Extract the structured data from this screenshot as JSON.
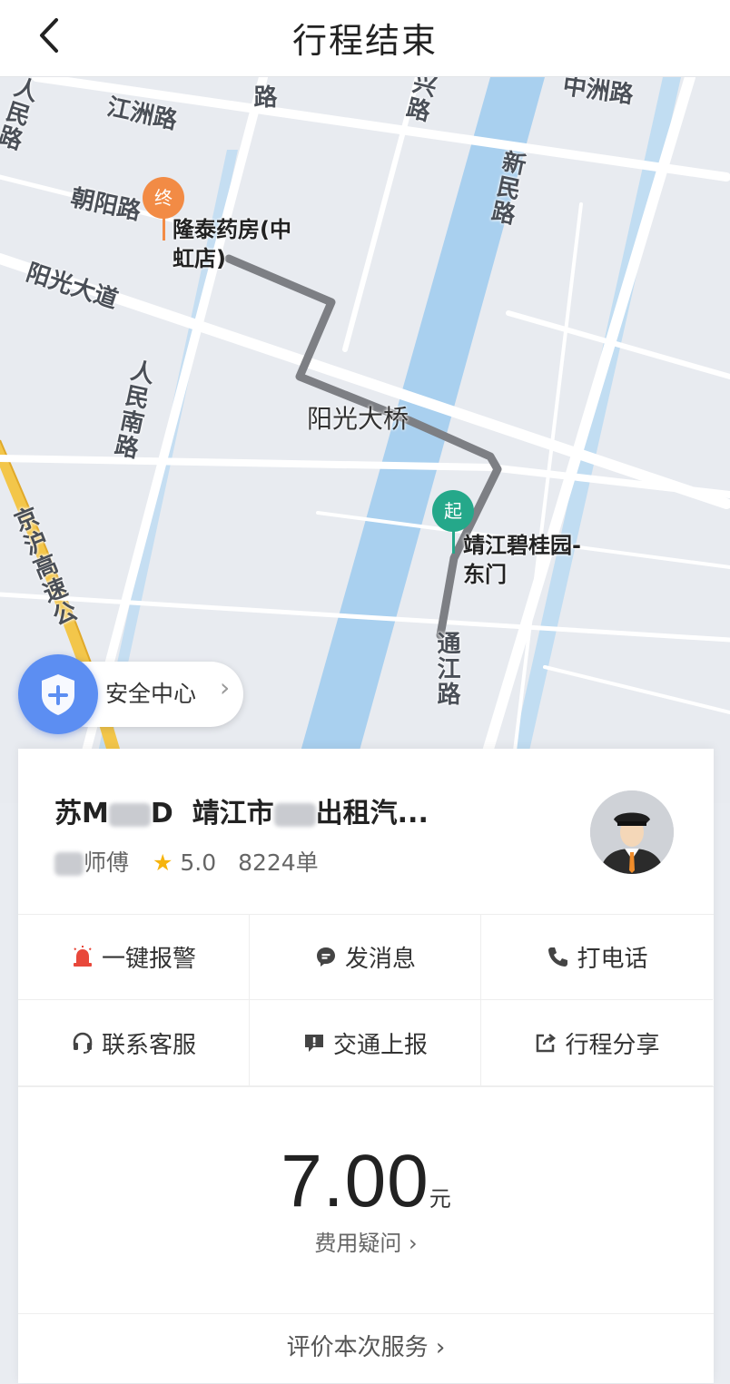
{
  "header": {
    "title": "行程结束"
  },
  "map": {
    "roads": [
      "江洲路",
      "朝阳路",
      "阳光大道",
      "人民南路",
      "京沪高速公",
      "新民路",
      "通江路",
      "中洲路",
      "阳光大桥",
      "人民路",
      "兴路",
      "路"
    ],
    "start": {
      "badge": "起",
      "name": "靖江碧桂园-东门",
      "color": "#25a88a"
    },
    "end": {
      "badge": "终",
      "name": "隆泰药房(中虹店)",
      "color": "#f28b45"
    },
    "route_color": "#7d7f84",
    "river_color": "#a9d0ef"
  },
  "safety": {
    "label": "安全中心"
  },
  "driver": {
    "plate_prefix": "苏M",
    "plate_suffix": "D",
    "company_prefix": "靖江市",
    "company_suffix": "出租汽...",
    "name_suffix": "师傅",
    "rating": "5.0",
    "orders": "8224单"
  },
  "actions": [
    {
      "label": "一键报警",
      "icon": "alarm-light-icon",
      "color": "#e8483b"
    },
    {
      "label": "发消息",
      "icon": "message-icon"
    },
    {
      "label": "打电话",
      "icon": "phone-icon"
    },
    {
      "label": "联系客服",
      "icon": "headset-icon"
    },
    {
      "label": "交通上报",
      "icon": "report-icon"
    },
    {
      "label": "行程分享",
      "icon": "share-icon"
    }
  ],
  "fare": {
    "amount": "7.00",
    "unit": "元",
    "question": "费用疑问"
  },
  "rate": {
    "label": "评价本次服务"
  }
}
